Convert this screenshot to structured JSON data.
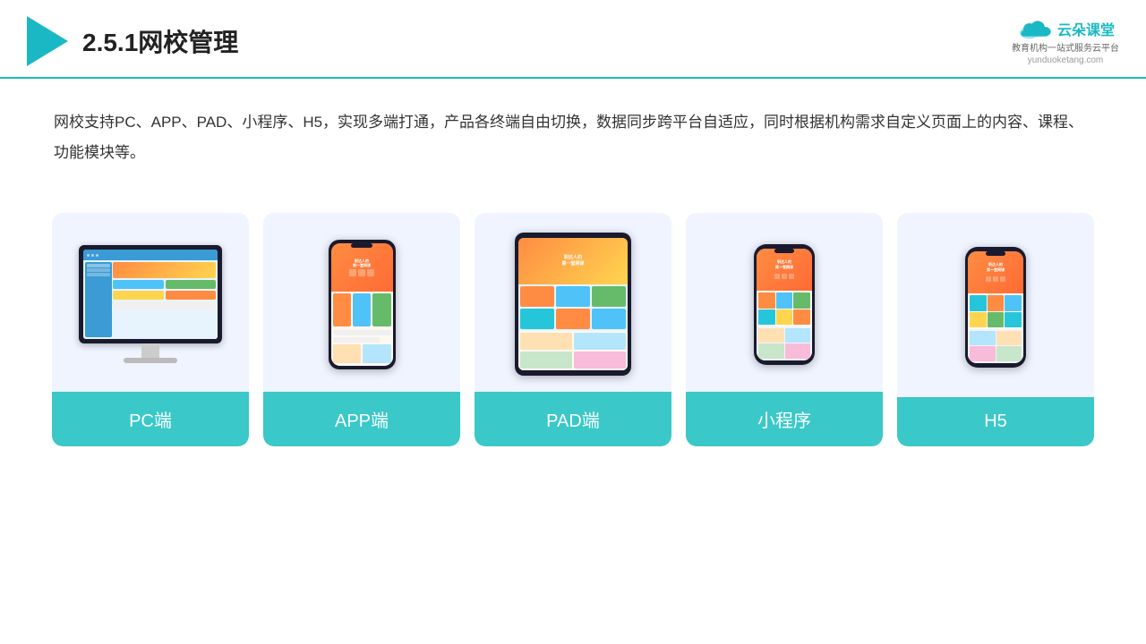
{
  "header": {
    "title": "2.5.1网校管理",
    "brand_name": "云朵课堂",
    "brand_url": "yunduoketang.com",
    "brand_slogan": "教育机构一站\n式服务云平台"
  },
  "description": {
    "text": "网校支持PC、APP、PAD、小程序、H5，实现多端打通，产品各终端自由切换，数据同步跨平台自适应，同时根据机构需求自定义页面上的内容、课程、功能模块等。"
  },
  "cards": [
    {
      "id": "pc",
      "label": "PC端"
    },
    {
      "id": "app",
      "label": "APP端"
    },
    {
      "id": "pad",
      "label": "PAD端"
    },
    {
      "id": "miniprogram",
      "label": "小程序"
    },
    {
      "id": "h5",
      "label": "H5"
    }
  ]
}
